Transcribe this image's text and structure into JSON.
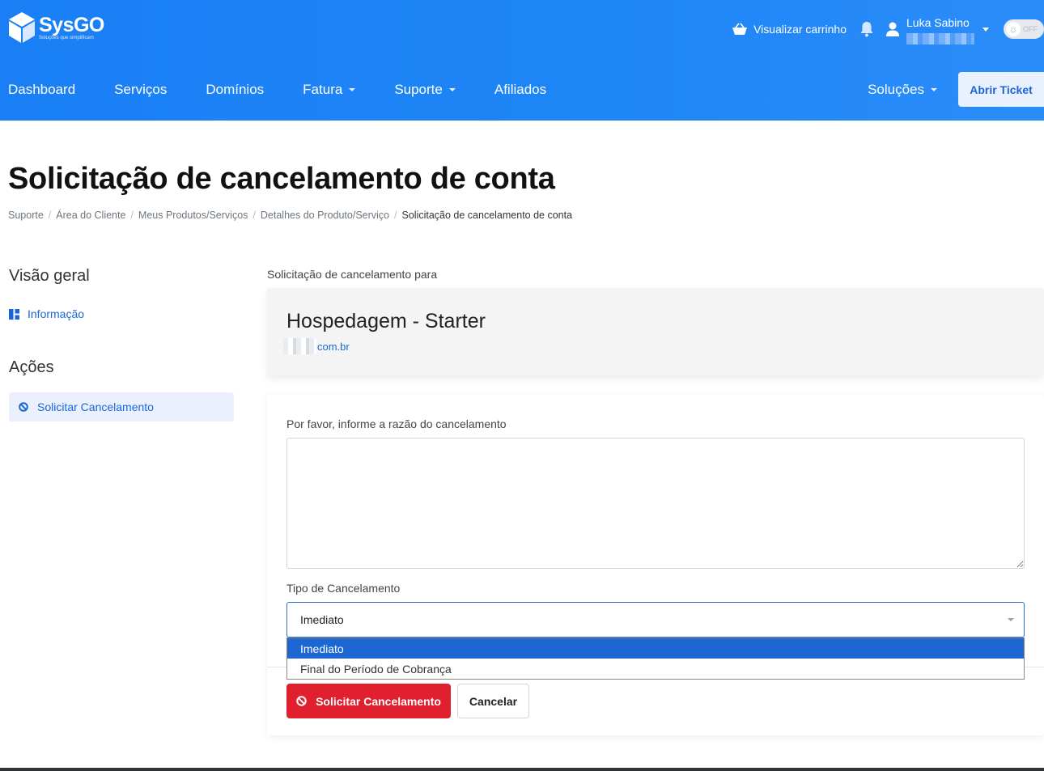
{
  "colors": {
    "header": "#1f86f7",
    "primary_link": "#1a66d9",
    "danger": "#e0202f",
    "select_highlight": "#1c67d2"
  },
  "logo": {
    "name": "SysGO",
    "tagline": "Soluções que simplificam"
  },
  "topbar": {
    "cart_label": "Visualizar carrinho",
    "cart_icon": "basket-icon",
    "bell_icon": "bell-icon",
    "user_name": "Luka Sabino",
    "user_icon": "user-icon",
    "theme_toggle_label": "OFF"
  },
  "nav": {
    "items": [
      {
        "label": "Dashboard"
      },
      {
        "label": "Serviços"
      },
      {
        "label": "Domínios"
      },
      {
        "label": "Fatura"
      },
      {
        "label": "Suporte"
      },
      {
        "label": "Afiliados"
      }
    ],
    "solutions_label": "Soluções",
    "open_ticket_label": "Abrir Ticket"
  },
  "page": {
    "title": "Solicitação de cancelamento de conta",
    "breadcrumb": [
      "Suporte",
      "Área do Cliente",
      "Meus Produtos/Serviços",
      "Detalhes do Produto/Serviço",
      "Solicitação de cancelamento de conta"
    ]
  },
  "sidebar": {
    "overview_heading": "Visão geral",
    "info_link": "Informação",
    "actions_heading": "Ações",
    "cancel_link": "Solicitar Cancelamento"
  },
  "product": {
    "for_label": "Solicitação de cancelamento para",
    "name": "Hospedagem - Starter",
    "domain_suffix": "com.br"
  },
  "form": {
    "reason_label": "Por favor, informe a razão do cancelamento",
    "reason_value": "",
    "type_label": "Tipo de Cancelamento",
    "type_selected": "Imediato",
    "type_options": [
      "Imediato",
      "Final do Período de Cobrança"
    ],
    "submit_label": "Solicitar Cancelamento",
    "cancel_label": "Cancelar"
  }
}
